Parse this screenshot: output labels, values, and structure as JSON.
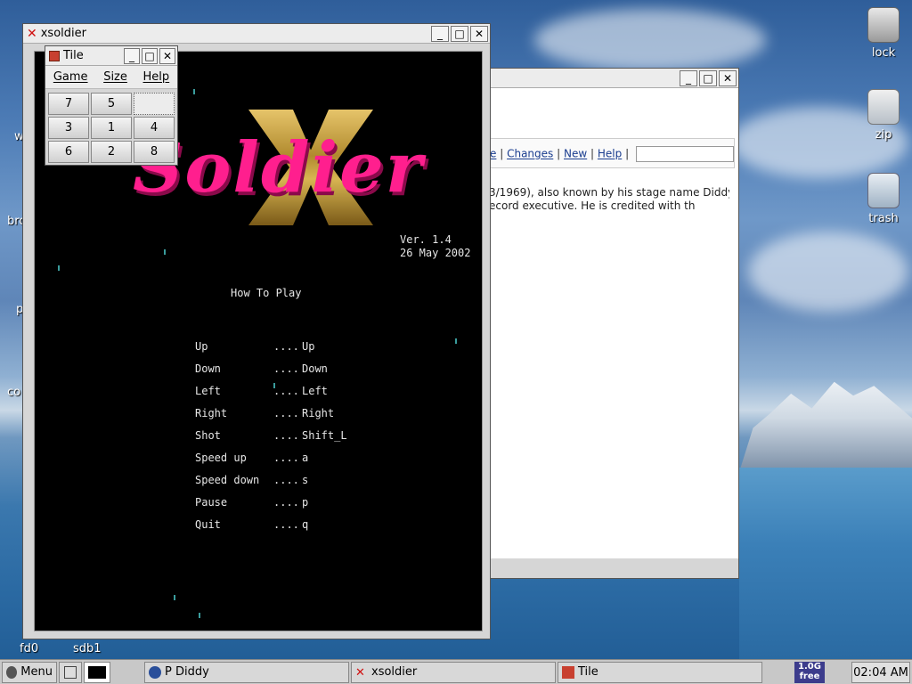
{
  "desktop": {
    "icons_right": [
      {
        "label": "lock"
      },
      {
        "label": "zip"
      },
      {
        "label": "trash"
      }
    ],
    "labels_left": [
      {
        "label": "w"
      },
      {
        "label": "bro"
      },
      {
        "label": "p"
      },
      {
        "label": "co"
      },
      {
        "label": "fd0"
      },
      {
        "label": "sdb1"
      }
    ]
  },
  "browser": {
    "nav": {
      "prefix": "e",
      "links": [
        "Changes",
        "New",
        "Help"
      ],
      "sep": "|"
    },
    "article_line1": "3/1969), also known by his stage name Diddy,",
    "article_line2": "ecord executive. He is credited with th"
  },
  "xsoldier": {
    "title": "xsoldier",
    "logo_text": "Soldier",
    "version": "Ver. 1.4",
    "date": "26 May 2002",
    "how_to_play": "How To Play",
    "controls": [
      {
        "action": "Up",
        "key": "Up"
      },
      {
        "action": "Down",
        "key": "Down"
      },
      {
        "action": "Left",
        "key": "Left"
      },
      {
        "action": "Right",
        "key": "Right"
      },
      {
        "action": "Shot",
        "key": "Shift_L"
      },
      {
        "action": "Speed up",
        "key": "a"
      },
      {
        "action": "Speed down",
        "key": "s"
      },
      {
        "action": "Pause",
        "key": "p"
      },
      {
        "action": "Quit",
        "key": "q"
      }
    ],
    "dots": "...."
  },
  "tile": {
    "title": "Tile",
    "menu": [
      "Game",
      "Size",
      "Help"
    ],
    "tiles": [
      "7",
      "5",
      "",
      "3",
      "1",
      "4",
      "6",
      "2",
      "8"
    ]
  },
  "taskbar": {
    "menu": "Menu",
    "tasks": [
      "P Diddy",
      "xsoldier",
      "Tile"
    ],
    "mem_line1": "1.0G",
    "mem_line2": "free",
    "clock": "02:04 AM"
  },
  "colors": {
    "logo_pink": "#ff1f8e",
    "game_bg": "#000000"
  }
}
